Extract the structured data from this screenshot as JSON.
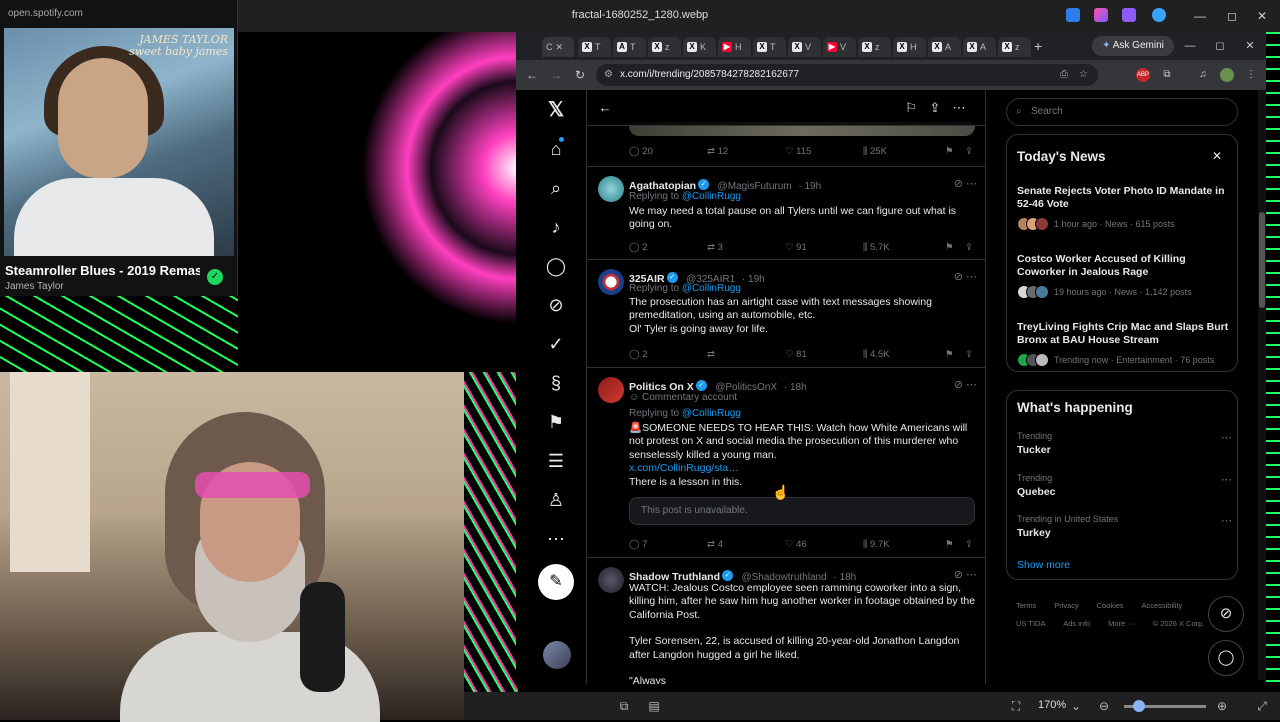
{
  "viewer": {
    "file_name": "fractal-1680252_1280.webp",
    "zoom_level": "170%",
    "zoom_fraction": 0.18
  },
  "spotify": {
    "url": "open.spotify.com",
    "album_text_1": "JAMES TAYLOR",
    "album_text_2": "sweet baby james",
    "song": "Steamroller Blues - 2019 Remas",
    "artist": "James Taylor"
  },
  "browser": {
    "tabs": [
      {
        "icon": "X",
        "label": "T"
      },
      {
        "icon": "A",
        "label": "T"
      },
      {
        "icon": "X",
        "label": "z"
      },
      {
        "icon": "X",
        "label": "K"
      },
      {
        "icon": "▶",
        "label": "H"
      },
      {
        "icon": "X",
        "label": "T"
      },
      {
        "icon": "X",
        "label": "V"
      },
      {
        "icon": "▶",
        "label": "V"
      },
      {
        "icon": "X",
        "label": "z"
      },
      {
        "icon": "X",
        "label": "H"
      },
      {
        "icon": "X",
        "label": "A"
      },
      {
        "icon": "X",
        "label": "A"
      },
      {
        "icon": "X",
        "label": "z"
      }
    ],
    "active_tab_label": "C",
    "gemini_label": "Ask Gemini",
    "url": "x.com/i/trending/2085784278282162677"
  },
  "feed": {
    "top_post_stats": {
      "replies": "20",
      "reposts": "12",
      "likes": "115",
      "views": "25K"
    },
    "posts": [
      {
        "name": "Agathatopian",
        "handle": "@MagisFuturum",
        "time": "19h",
        "reply_to_label": "Replying to ",
        "reply_to": "@CollinRugg",
        "text": "We may need a total pause on all Tylers until we can figure out what is going on.",
        "replies": "2",
        "reposts": "3",
        "likes": "91",
        "views": "5.7K"
      },
      {
        "name": "325AIR",
        "handle": "@325AIR1",
        "time": "19h",
        "reply_to_label": "Replying to ",
        "reply_to": "@CollinRugg",
        "text_1": "The prosecution has an airtight case with text messages showing premeditation, using an automobile, etc.",
        "text_2": "Ol' Tyler is going away for life.",
        "replies": "2",
        "reposts": "",
        "likes": "81",
        "views": "4.5K"
      },
      {
        "name": "Politics On X",
        "handle": "@PoliticsOnX",
        "time": "18h",
        "account_type": "Commentary account",
        "reply_to_label": "Replying to ",
        "reply_to": "@CollinRugg",
        "text_1": "🚨SOMEONE NEEDS TO HEAR THIS: Watch how White Americans will not protest on X and social media the prosecution of this murderer who senselessly killed a young man.",
        "link": "x.com/CollinRugg/sta…",
        "text_2": "There is a lesson in this.",
        "unavailable": "This post is unavailable.",
        "replies": "7",
        "reposts": "4",
        "likes": "46",
        "views": "9.7K"
      },
      {
        "name": "Shadow Truthland",
        "handle": "@Shadowtruthland",
        "time": "18h",
        "text_1": "WATCH: Jealous Costco employee seen ramming coworker into a sign, killing him, after he saw him hug another worker in footage obtained by the California Post.",
        "text_2": "Tyler Sorensen, 22, is accused of killing 20-year-old Jonathon Langdon after Langdon hugged a girl he liked.",
        "text_3": "\"Always"
      }
    ]
  },
  "sidebar": {
    "search_placeholder": "Search",
    "news_title": "Today's News",
    "news": [
      {
        "title": "Senate Rejects Voter Photo ID Mandate in 52-46 Vote",
        "meta": "1 hour ago · News · 615 posts"
      },
      {
        "title": "Costco Worker Accused of Killing Coworker in Jealous Rage",
        "meta": "19 hours ago · News · 1,142 posts"
      },
      {
        "title": "TreyLiving Fights Crip Mac and Slaps Burt Bronx at BAU House Stream",
        "meta": "Trending now · Entertainment · 76 posts"
      }
    ],
    "happening_title": "What's happening",
    "trends": [
      {
        "category": "Trending",
        "name": "Tucker"
      },
      {
        "category": "Trending",
        "name": "Quebec"
      },
      {
        "category": "Trending in United States",
        "name": "Turkey"
      }
    ],
    "show_more": "Show more",
    "footer": {
      "terms": "Terms",
      "privacy": "Privacy",
      "cookies": "Cookies",
      "accessibility": "Accessibility",
      "us_tida": "US TIDA",
      "ads_info": "Ads info",
      "more": "More ···",
      "copyright": "© 2026 X Corp."
    }
  },
  "colors": {
    "accent": "#1d9bf0",
    "background": "#000000",
    "spotify_green": "#1ed760"
  }
}
